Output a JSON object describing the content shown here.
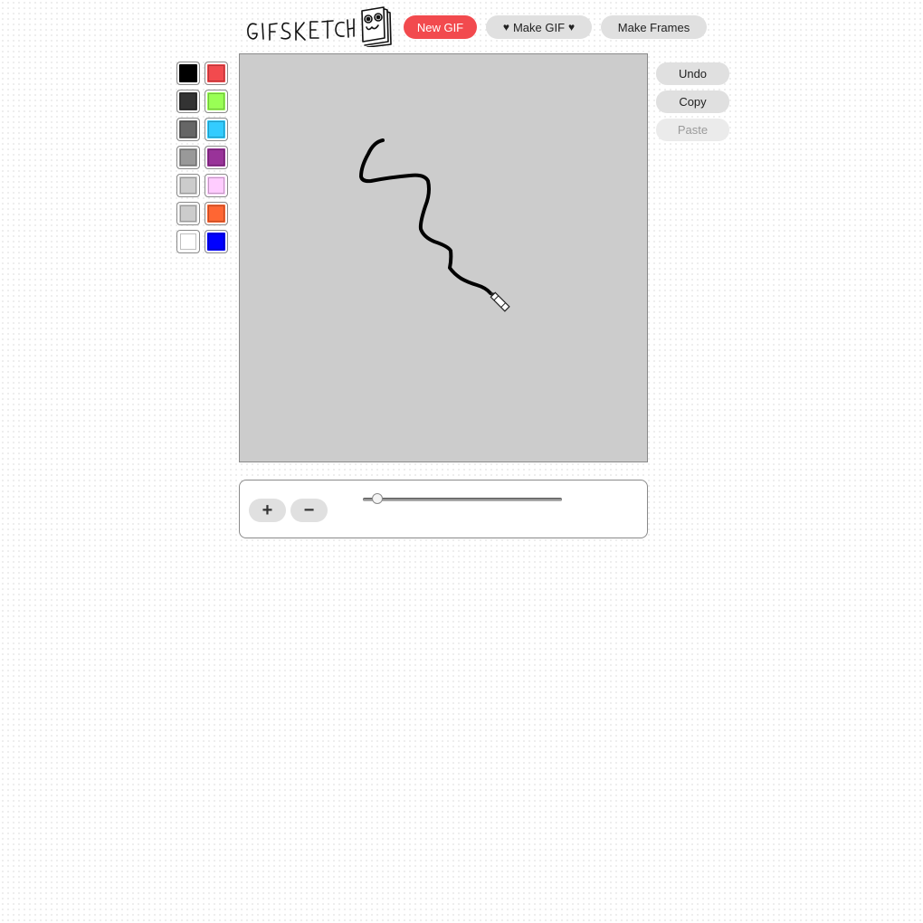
{
  "app": {
    "logo_text": "GIFSKETCH"
  },
  "toolbar": {
    "new_gif_label": "New GIF",
    "make_gif_label": "Make GIF",
    "make_frames_label": "Make Frames"
  },
  "palette": {
    "colors": [
      "#000000",
      "#f24a4e",
      "#333333",
      "#99ff55",
      "#666666",
      "#33ccff",
      "#999999",
      "#993399",
      "#cccccc",
      "#ffccff",
      "#cccccc",
      "#ff6633",
      "#ffffff",
      "#0000ff"
    ]
  },
  "canvas": {
    "background_color": "#cccccc",
    "stroke_color": "#000000",
    "cursor_icon": "pencil-icon"
  },
  "side_actions": {
    "undo_label": "Undo",
    "copy_label": "Copy",
    "paste_label": "Paste"
  },
  "brush": {
    "increase_label": "+",
    "decrease_label": "−",
    "size_level": 0.05
  }
}
